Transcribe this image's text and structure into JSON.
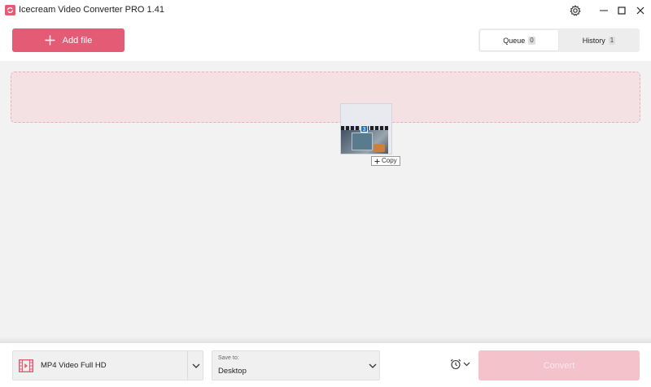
{
  "window": {
    "title": "Icecream Video Converter PRO 1.41",
    "icons": {
      "app": "app-logo-icon",
      "settings": "gear-icon",
      "minimize": "minimize-icon",
      "maximize": "maximize-icon",
      "close": "close-icon"
    }
  },
  "toolbar": {
    "add_file_label": "Add file",
    "add_icon": "plus-icon",
    "tabs": [
      {
        "label": "Queue",
        "count": "0",
        "active": true
      },
      {
        "label": "History",
        "count": "1",
        "active": false
      }
    ]
  },
  "drag": {
    "badge": "3",
    "copy_label": "Copy",
    "copy_icon": "plus-icon"
  },
  "bottom": {
    "format_label": "MP4 Video Full HD",
    "format_icon": "film-icon",
    "save_caption": "Save to:",
    "save_value": "Desktop",
    "schedule_icon": "alarm-clock-icon",
    "convert_label": "Convert"
  },
  "colors": {
    "accent": "#e35b74",
    "accent_disabled": "#f3c2cb",
    "dropzone_bg": "#f3e1e4",
    "dropzone_border": "#e4b1ba",
    "background": "#f2f2f2"
  }
}
